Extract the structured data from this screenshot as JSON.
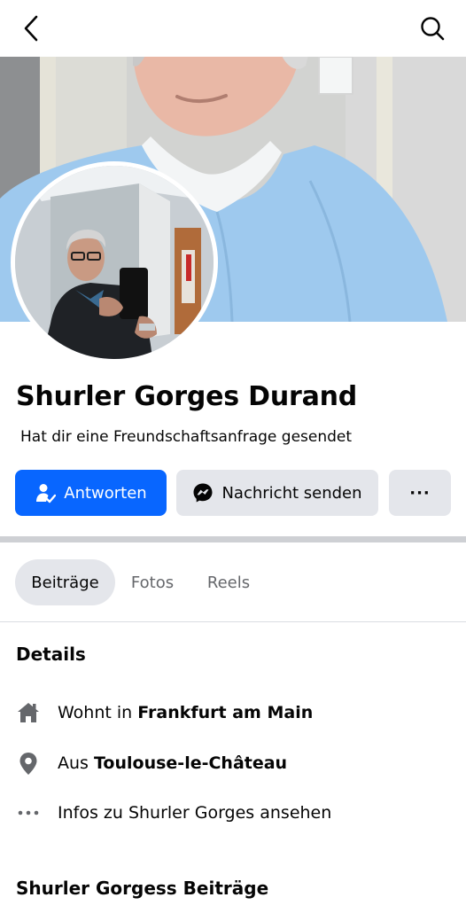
{
  "topbar": {
    "back_icon": "chevron-left-icon",
    "search_icon": "search-icon"
  },
  "profile": {
    "name": "Shurler Gorges Durand",
    "status": "Hat dir eine Freundschaftsanfrage gesendet"
  },
  "actions": {
    "respond_label": "Antworten",
    "message_label": "Nachricht senden",
    "more_label": "···"
  },
  "tabs": [
    {
      "label": "Beiträge",
      "active": true
    },
    {
      "label": "Fotos",
      "active": false
    },
    {
      "label": "Reels",
      "active": false
    }
  ],
  "details": {
    "title": "Details",
    "lives_prefix": "Wohnt in",
    "lives_place": "Frankfurt am Main",
    "from_prefix": "Aus",
    "from_place": "Toulouse-le-Château",
    "info_text": "Infos zu Shurler Gorges ansehen"
  },
  "posts": {
    "title": "Shurler Gorgess Beiträge"
  },
  "colors": {
    "primary": "#0866ff",
    "secondary_bg": "#e4e6eb",
    "text": "#050505",
    "muted": "#65676b"
  }
}
